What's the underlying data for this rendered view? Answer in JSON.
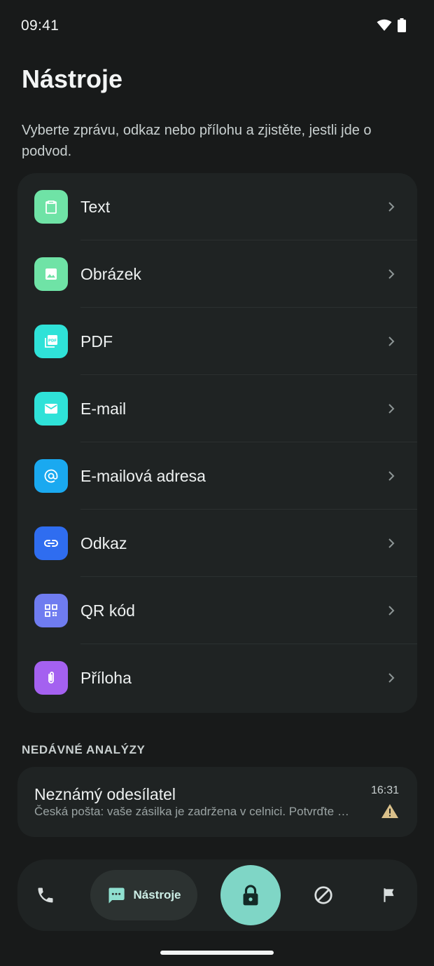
{
  "status": {
    "time": "09:41"
  },
  "page": {
    "title": "Nástroje",
    "subtitle": "Vyberte zprávu, odkaz nebo přílohu a zjistěte, jestli jde o podvod."
  },
  "tools": [
    {
      "label": "Text",
      "icon": "clipboard-icon",
      "color": "#6fe3a6"
    },
    {
      "label": "Obrázek",
      "icon": "image-icon",
      "color": "#6fe3a6"
    },
    {
      "label": "PDF",
      "icon": "pdf-icon",
      "color": "#2fe2d8"
    },
    {
      "label": "E-mail",
      "icon": "mail-icon",
      "color": "#2fe2d8"
    },
    {
      "label": "E-mailová adresa",
      "icon": "at-icon",
      "color": "#1aa9f0"
    },
    {
      "label": "Odkaz",
      "icon": "link-icon",
      "color": "#2f6df0"
    },
    {
      "label": "QR kód",
      "icon": "qr-icon",
      "color": "#6f7cf0"
    },
    {
      "label": "Příloha",
      "icon": "paperclip-icon",
      "color": "#a461f0"
    }
  ],
  "recent": {
    "heading": "NEDÁVNÉ ANALÝZY",
    "items": [
      {
        "sender": "Neznámý odesílatel",
        "preview": "Česká pošta: vaše zásilka je zadržena v celnici. Potvrďte platbu",
        "time": "16:31",
        "status_icon": "warning-icon",
        "status_color": "#d9c08a"
      }
    ]
  },
  "nav": {
    "active_label": "Nástroje",
    "items": [
      "phone-icon",
      "message-icon",
      "lock-icon",
      "block-icon",
      "flag-icon"
    ],
    "accent": "#7fd6c6"
  }
}
